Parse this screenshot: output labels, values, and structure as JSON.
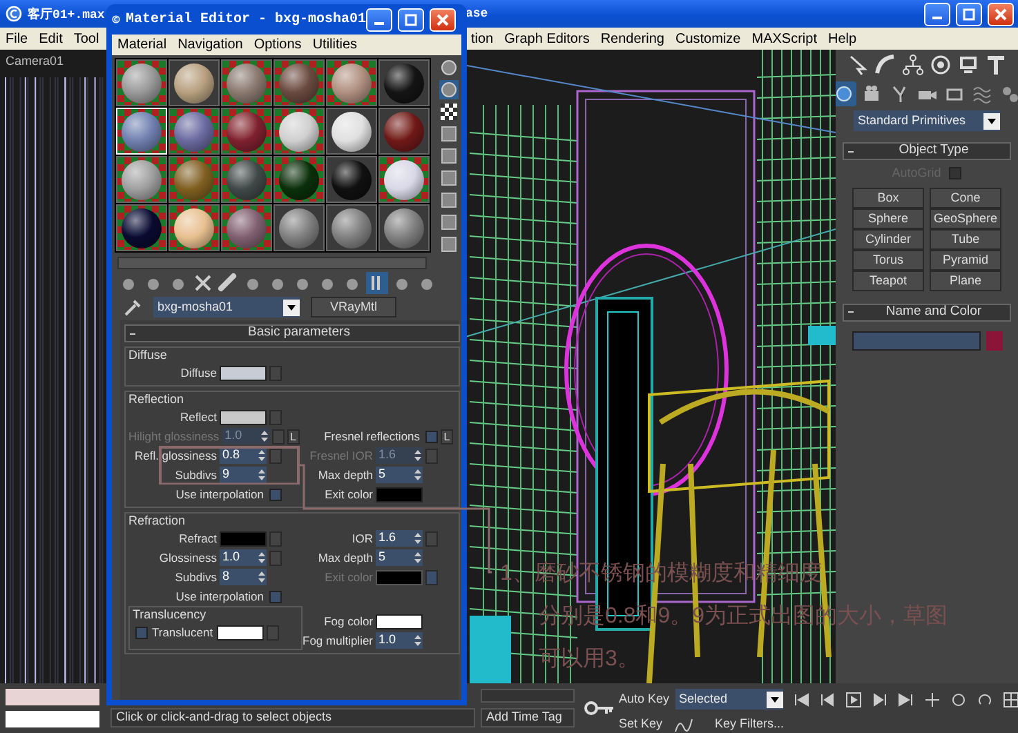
{
  "main_window": {
    "title": "客厅01+.max",
    "title_fragment": "ase"
  },
  "main_menu": {
    "left": [
      "File",
      "Edit",
      "Tool"
    ],
    "right": [
      "tion",
      "Graph Editors",
      "Rendering",
      "Customize",
      "MAXScript",
      "Help"
    ]
  },
  "viewport": {
    "label": "Camera01"
  },
  "material_editor": {
    "title": "Material Editor - bxg-mosha01",
    "menu": [
      "Material",
      "Navigation",
      "Options",
      "Utilities"
    ],
    "slots": [
      {
        "color": "#9a9a9a",
        "kind": "checker",
        "selected": false
      },
      {
        "color": "#b8a080",
        "kind": "plain",
        "selected": false
      },
      {
        "color": "#8a7a70",
        "kind": "checker",
        "selected": false
      },
      {
        "color": "#6a4a40",
        "kind": "checker",
        "selected": false
      },
      {
        "color": "#b09080",
        "kind": "checker",
        "selected": false
      },
      {
        "color": "#141414",
        "kind": "plain",
        "selected": false
      },
      {
        "color": "#7080b0",
        "kind": "checker",
        "selected": true
      },
      {
        "color": "#6a6aa0",
        "kind": "checker",
        "selected": false
      },
      {
        "color": "#802030",
        "kind": "checker",
        "selected": false
      },
      {
        "color": "#d0d0d0",
        "kind": "checker",
        "selected": false
      },
      {
        "color": "#e0e0e0",
        "kind": "plain",
        "selected": false
      },
      {
        "color": "#701818",
        "kind": "plain",
        "selected": false
      },
      {
        "color": "#a0a0a0",
        "kind": "checker",
        "selected": false
      },
      {
        "color": "#806020",
        "kind": "checker",
        "selected": false
      },
      {
        "color": "#404848",
        "kind": "checker",
        "selected": false
      },
      {
        "color": "#0a300a",
        "kind": "checker",
        "selected": false
      },
      {
        "color": "#101010",
        "kind": "plain",
        "selected": false
      },
      {
        "color": "#d8d8e8",
        "kind": "checker",
        "selected": false
      },
      {
        "color": "#0a0a30",
        "kind": "checker",
        "selected": false
      },
      {
        "color": "#e8c090",
        "kind": "checker",
        "selected": false
      },
      {
        "color": "#806070",
        "kind": "checker",
        "selected": false
      },
      {
        "color": "#808080",
        "kind": "plain",
        "selected": false
      },
      {
        "color": "#808080",
        "kind": "plain",
        "selected": false
      },
      {
        "color": "#808080",
        "kind": "plain",
        "selected": false
      }
    ],
    "material_name": "bxg-mosha01",
    "material_type": "VRayMtl",
    "rollout_title": "Basic parameters",
    "groups": [
      {
        "title": "Diffuse",
        "rows": [
          {
            "left": {
              "kind": "swatch",
              "label": "Diffuse",
              "color": "#c8ccd4",
              "disabled": false,
              "map": true
            }
          }
        ]
      },
      {
        "title": "Reflection",
        "rows": [
          {
            "left": {
              "kind": "swatch",
              "label": "Reflect",
              "color": "#c8c8c8",
              "disabled": false,
              "map": true
            }
          },
          {
            "left": {
              "kind": "spinner",
              "label": "Hilight glossiness",
              "value": "1.0",
              "disabled": true,
              "map": true,
              "lock": "L"
            },
            "right": {
              "kind": "checkbox",
              "label": "Fresnel reflections",
              "checked": false,
              "lock": "L"
            }
          },
          {
            "left": {
              "kind": "spinner",
              "label": "Refl. glossiness",
              "value": "0.8",
              "disabled": false,
              "map": true
            },
            "right": {
              "kind": "spinner",
              "label": "Fresnel IOR",
              "value": "1.6",
              "disabled": true,
              "map": true
            }
          },
          {
            "left": {
              "kind": "spinner",
              "label": "Subdivs",
              "value": "9",
              "disabled": false
            },
            "right": {
              "kind": "spinner",
              "label": "Max depth",
              "value": "5",
              "disabled": false
            }
          },
          {
            "left": {
              "kind": "checkbox",
              "label": "Use interpolation",
              "checked": false
            },
            "right": {
              "kind": "swatch",
              "label": "Exit color",
              "color": "#000000",
              "disabled": false
            }
          }
        ]
      },
      {
        "title": "Refraction",
        "rows": [
          {
            "left": {
              "kind": "swatch",
              "label": "Refract",
              "color": "#000000",
              "disabled": false,
              "map": true
            },
            "right": {
              "kind": "spinner",
              "label": "IOR",
              "value": "1.6",
              "disabled": false,
              "map": true
            }
          },
          {
            "left": {
              "kind": "spinner",
              "label": "Glossiness",
              "value": "1.0",
              "disabled": false,
              "map": true
            },
            "right": {
              "kind": "spinner",
              "label": "Max depth",
              "value": "5",
              "disabled": false
            }
          },
          {
            "left": {
              "kind": "spinner",
              "label": "Subdivs",
              "value": "8",
              "disabled": false
            },
            "right": {
              "kind": "swatch",
              "label": "Exit color",
              "color": "#000000",
              "disabled": true,
              "map": true
            }
          },
          {
            "left": {
              "kind": "checkbox",
              "label": "Use interpolation",
              "checked": false
            }
          }
        ],
        "translucency": {
          "title": "Translucency",
          "translucent": {
            "kind": "leading_checkbox",
            "label": "Translucent",
            "checked": false,
            "color": "#ffffff"
          },
          "fog_color": {
            "kind": "swatch",
            "label": "Fog color",
            "color": "#ffffff",
            "disabled": false
          },
          "fog_multiplier": {
            "kind": "spinner",
            "label": "Fog multiplier",
            "value": "1.0",
            "disabled": false
          }
        }
      }
    ]
  },
  "annotation": {
    "lines": [
      "1、磨砂不锈钢的模糊度和精细度",
      "分别是0.8和9。9为正式出图的大小，草图",
      "可以用3。"
    ]
  },
  "command_panel": {
    "category": "Standard Primitives",
    "object_type": {
      "title": "Object Type",
      "autogrid": {
        "label": "AutoGrid",
        "checked": false,
        "disabled": true
      },
      "buttons": [
        "Box",
        "Cone",
        "Sphere",
        "GeoSphere",
        "Cylinder",
        "Tube",
        "Torus",
        "Pyramid",
        "Teapot",
        "Plane"
      ]
    },
    "name_and_color": {
      "title": "Name and Color",
      "color": "#8b1538"
    }
  },
  "bottom_bar": {
    "time_tag": "Add Time Tag",
    "status": "Click or click-and-drag to select objects",
    "auto_key": "Auto Key",
    "key_mode": "Selected",
    "set_key": "Set Key",
    "key_filters": "Key Filters..."
  }
}
